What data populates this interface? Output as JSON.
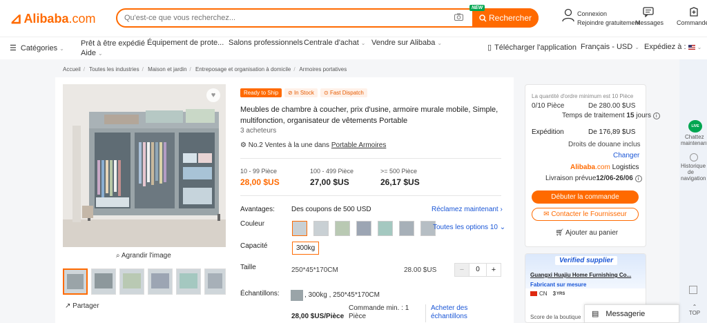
{
  "header": {
    "logo_mark": "⊿",
    "logo_text": "Alibaba",
    "logo_domain": ".com",
    "search_placeholder": "Qu'est-ce que vous recherchez...",
    "new_badge": "NEW",
    "search_button": "Rechercher",
    "account_line1": "Connexion",
    "account_line2": "Rejoindre gratuitement",
    "messages": "Messages",
    "orders": "Commandes"
  },
  "nav": {
    "categories": "Catégories",
    "ready": "Prêt à être expédié",
    "aide": "Aide",
    "equipment": "Équipement de prote...",
    "salons": "Salons professionnels",
    "centrale": "Centrale d'achat",
    "vendre": "Vendre sur Alibaba",
    "download": "Télécharger l'application",
    "lang": "Français - USD",
    "ship": "Expédiez à :"
  },
  "breadcrumb": [
    "Accueil",
    "Toutes les industries",
    "Maison et jardin",
    "Entreposage et organisation à domicile",
    "Armoires portatives"
  ],
  "product": {
    "badge_ready": "Ready to Ship",
    "badge_stock": "In Stock",
    "badge_fast": "Fast Dispatch",
    "title": "Meubles de chambre à coucher, prix d'usine, armoire murale mobile, Simple, multifonction, organisateur de vêtements Portable",
    "buyers": "3 acheteurs",
    "rank_prefix": "No.2 Ventes à la une dans",
    "rank_link": "Portable Armoires",
    "enlarge": "Agrandir l'image",
    "share": "Partager"
  },
  "prices": [
    {
      "range": "10 - 99 Pièce",
      "price": "28,00 $US"
    },
    {
      "range": "100 - 499 Pièce",
      "price": "27,00 $US"
    },
    {
      "range": ">= 500 Pièce",
      "price": "26,17 $US"
    }
  ],
  "options": {
    "avantages_label": "Avantages:",
    "avantages_value": "Des coupons de 500 USD",
    "avantages_link": "Réclamez maintenant",
    "couleur_label": "Couleur",
    "couleur_link": "Toutes les options 10",
    "capacite_label": "Capacité",
    "capacite_value": "300kg",
    "taille_label": "Taille",
    "taille_value": "250*45*170CM",
    "taille_price": "28.00 $US",
    "qty": "0",
    "minus": "−",
    "plus": "+",
    "echantillons_label": "Échantillons:",
    "echantillons_value": ", 300kg , 250*45*170CM",
    "sample_price": "28,00 $US/Pièce",
    "sample_min_line1": "Commande min. : 1",
    "sample_min_line2": "Pièce",
    "sample_buy_line1": "Acheter des",
    "sample_buy_line2": "échantillons"
  },
  "order_panel": {
    "moq": "La quantité d'ordre minimum est 10 Pièce",
    "count": "0/10 Pièce",
    "subtotal": "De 280.00 $US",
    "treatment_prefix": "Temps de traitement",
    "treatment_days": "15",
    "treatment_suffix": "jours",
    "shipping_label": "Expédition",
    "shipping_value": "De 176,89 $US",
    "customs": "Droits de douane inclus",
    "change": "Changer",
    "logistics_brand": "Alibaba",
    "logistics_domain": ".com",
    "logistics": "Logistics",
    "delivery_prefix": "Livraison prévue",
    "delivery_dates": "12/06-26/06",
    "start_order": "Débuter la commande",
    "contact": "Contacter le Fournisseur",
    "add_cart": "Ajouter au panier"
  },
  "supplier": {
    "verified": "Verified supplier",
    "name": "Guangxi Huajiu Home Furnishing Co...",
    "type": "Fabricant sur mesure",
    "country": "CN",
    "years": "3",
    "years_unit": "YRS",
    "score": "Score de la boutique"
  },
  "rail": {
    "chat_badge": "LIVE",
    "chat_line1": "Chattez",
    "chat_line2": "maintenant",
    "history_line1": "Historique",
    "history_line2": "de",
    "history_line3": "navigation",
    "top": "TOP"
  },
  "messagerie": "Messagerie",
  "colors": {
    "brand": "#ff6a00",
    "verified_blue": "#1a56d6",
    "green": "#00a651"
  }
}
